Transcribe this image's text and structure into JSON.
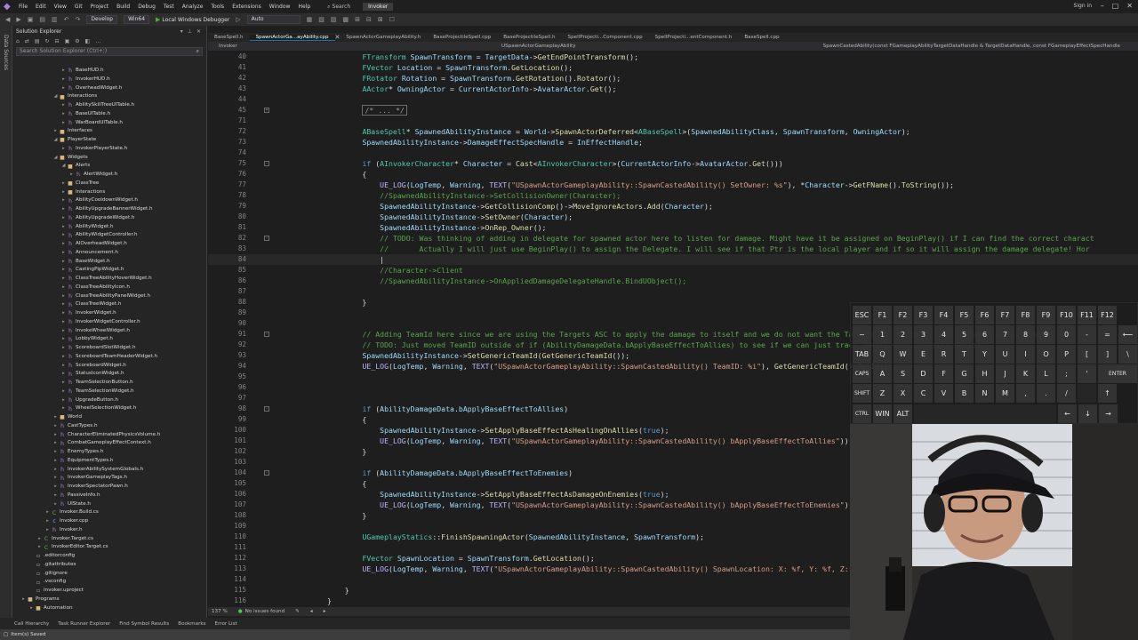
{
  "menubar": {
    "items": [
      "File",
      "Edit",
      "View",
      "Git",
      "Project",
      "Build",
      "Debug",
      "Test",
      "Analyze",
      "Tools",
      "Extensions",
      "Window",
      "Help"
    ],
    "search_label": "Search",
    "solution_name": "Invoker",
    "signin": "Sign in"
  },
  "toolbar": {
    "config": "Develop",
    "platform": "Win64",
    "debugger": "Local Windows Debugger",
    "auto": "Auto"
  },
  "leftstrip": {
    "label": "Data Sources"
  },
  "solution_explorer": {
    "title": "Solution Explorer",
    "search_placeholder": "Search Solution Explorer (Ctrl+;)",
    "tree": [
      {
        "label": "BaseHUD.h",
        "icon": "file-h",
        "indent": 6,
        "arrow": "▸"
      },
      {
        "label": "InvokerHUD.h",
        "icon": "file-h",
        "indent": 6,
        "arrow": "▸"
      },
      {
        "label": "OverheadWidget.h",
        "icon": "file-h",
        "indent": 6,
        "arrow": "▸"
      },
      {
        "label": "Interactions",
        "icon": "folder",
        "indent": 5,
        "arrow": "◢"
      },
      {
        "label": "AbilitySkillTreeUITable.h",
        "icon": "file-h",
        "indent": 6,
        "arrow": "▸"
      },
      {
        "label": "BaseUITable.h",
        "icon": "file-h",
        "indent": 6,
        "arrow": "▸"
      },
      {
        "label": "WarBoardUITable.h",
        "icon": "file-h",
        "indent": 6,
        "arrow": "▸"
      },
      {
        "label": "Interfaces",
        "icon": "folder",
        "indent": 5,
        "arrow": "▸"
      },
      {
        "label": "PlayerState",
        "icon": "folder",
        "indent": 5,
        "arrow": "◢"
      },
      {
        "label": "InvokerPlayerState.h",
        "icon": "file-h",
        "indent": 6,
        "arrow": "▸"
      },
      {
        "label": "Widgets",
        "icon": "folder",
        "indent": 5,
        "arrow": "◢"
      },
      {
        "label": "Alerts",
        "icon": "folder",
        "indent": 6,
        "arrow": "◢"
      },
      {
        "label": "AlertWidget.h",
        "icon": "file-h",
        "indent": 7,
        "arrow": "▸"
      },
      {
        "label": "ClassTree",
        "icon": "folder",
        "indent": 6,
        "arrow": "▸"
      },
      {
        "label": "Interactions",
        "icon": "folder",
        "indent": 6,
        "arrow": "▸"
      },
      {
        "label": "AbilityCooldownWidget.h",
        "icon": "file-h",
        "indent": 6,
        "arrow": "▸"
      },
      {
        "label": "AbilityUpgradeBannerWidget.h",
        "icon": "file-h",
        "indent": 6,
        "arrow": "▸"
      },
      {
        "label": "AbilityUpgradeWidget.h",
        "icon": "file-h",
        "indent": 6,
        "arrow": "▸"
      },
      {
        "label": "AbilityWidget.h",
        "icon": "file-h",
        "indent": 6,
        "arrow": "▸"
      },
      {
        "label": "AbilityWidgetController.h",
        "icon": "file-h",
        "indent": 6,
        "arrow": "▸"
      },
      {
        "label": "AIOverheadWidget.h",
        "icon": "file-h",
        "indent": 6,
        "arrow": "▸"
      },
      {
        "label": "Announcement.h",
        "icon": "file-h",
        "indent": 6,
        "arrow": "▸"
      },
      {
        "label": "BaseWidget.h",
        "icon": "file-h",
        "indent": 6,
        "arrow": "▸"
      },
      {
        "label": "CastingPipWidget.h",
        "icon": "file-h",
        "indent": 6,
        "arrow": "▸"
      },
      {
        "label": "ClassTreeAbilityHoverWidget.h",
        "icon": "file-h",
        "indent": 6,
        "arrow": "▸"
      },
      {
        "label": "ClassTreeAbilityIcon.h",
        "icon": "file-h",
        "indent": 6,
        "arrow": "▸"
      },
      {
        "label": "ClassTreeAbilityPanelWidget.h",
        "icon": "file-h",
        "indent": 6,
        "arrow": "▸"
      },
      {
        "label": "ClassTreeWidget.h",
        "icon": "file-h",
        "indent": 6,
        "arrow": "▸"
      },
      {
        "label": "InvokerWidget.h",
        "icon": "file-h",
        "indent": 6,
        "arrow": "▸"
      },
      {
        "label": "InvokerWidgetController.h",
        "icon": "file-h",
        "indent": 6,
        "arrow": "▸"
      },
      {
        "label": "InvokeWheelWidget.h",
        "icon": "file-h",
        "indent": 6,
        "arrow": "▸"
      },
      {
        "label": "LobbyWidget.h",
        "icon": "file-h",
        "indent": 6,
        "arrow": "▸"
      },
      {
        "label": "ScoreboardSlotWidget.h",
        "icon": "file-h",
        "indent": 6,
        "arrow": "▸"
      },
      {
        "label": "ScoreboardTeamHeaderWidget.h",
        "icon": "file-h",
        "indent": 6,
        "arrow": "▸"
      },
      {
        "label": "ScoreboardWidget.h",
        "icon": "file-h",
        "indent": 6,
        "arrow": "▸"
      },
      {
        "label": "StatusIconWidget.h",
        "icon": "file-h",
        "indent": 6,
        "arrow": "▸"
      },
      {
        "label": "TeamSelectionButton.h",
        "icon": "file-h",
        "indent": 6,
        "arrow": "▸"
      },
      {
        "label": "TeamSelectionWidget.h",
        "icon": "file-h",
        "indent": 6,
        "arrow": "▸"
      },
      {
        "label": "UpgradeButton.h",
        "icon": "file-h",
        "indent": 6,
        "arrow": "▸"
      },
      {
        "label": "WheelSelectionWidget.h",
        "icon": "file-h",
        "indent": 6,
        "arrow": "▸"
      },
      {
        "label": "World",
        "icon": "folder",
        "indent": 5,
        "arrow": "▸"
      },
      {
        "label": "CastTypes.h",
        "icon": "file-h",
        "indent": 5,
        "arrow": "▸"
      },
      {
        "label": "CharacterEliminatedPhysicsVolume.h",
        "icon": "file-h",
        "indent": 5,
        "arrow": "▸"
      },
      {
        "label": "CombatGameplayEffectContext.h",
        "icon": "file-h",
        "indent": 5,
        "arrow": "▸"
      },
      {
        "label": "EnemyTypes.h",
        "icon": "file-h",
        "indent": 5,
        "arrow": "▸"
      },
      {
        "label": "EquipmentTypes.h",
        "icon": "file-h",
        "indent": 5,
        "arrow": "▸"
      },
      {
        "label": "InvokerAbilitySystemGlobals.h",
        "icon": "file-h",
        "indent": 5,
        "arrow": "▸"
      },
      {
        "label": "InvokerGameplayTags.h",
        "icon": "file-h",
        "indent": 5,
        "arrow": "▸"
      },
      {
        "label": "InvokerSpectatorPawn.h",
        "icon": "file-h",
        "indent": 5,
        "arrow": "▸"
      },
      {
        "label": "PassiveInfo.h",
        "icon": "file-h",
        "indent": 5,
        "arrow": "▸"
      },
      {
        "label": "UIState.h",
        "icon": "file-h",
        "indent": 5,
        "arrow": "▸"
      },
      {
        "label": "Invoker.Build.cs",
        "icon": "file-cs",
        "indent": 4,
        "arrow": "▸"
      },
      {
        "label": "Invoker.cpp",
        "icon": "file-cpp",
        "indent": 4,
        "arrow": "▸"
      },
      {
        "label": "Invoker.h",
        "icon": "file-h",
        "indent": 4,
        "arrow": "▸"
      },
      {
        "label": "Invoker.Target.cs",
        "icon": "file-cs",
        "indent": 3,
        "arrow": "▸"
      },
      {
        "label": "InvokerEditor.Target.cs",
        "icon": "file-cs",
        "indent": 3,
        "arrow": "▸"
      },
      {
        "label": ".editorconfig",
        "icon": "file-other",
        "indent": 2,
        "arrow": ""
      },
      {
        "label": ".gitattributes",
        "icon": "file-other",
        "indent": 2,
        "arrow": ""
      },
      {
        "label": ".gitignore",
        "icon": "file-other",
        "indent": 2,
        "arrow": ""
      },
      {
        "label": ".vsconfig",
        "icon": "file-other",
        "indent": 2,
        "arrow": ""
      },
      {
        "label": "Invoker.uproject",
        "icon": "file-other",
        "indent": 2,
        "arrow": ""
      },
      {
        "label": "Programs",
        "icon": "folder",
        "indent": 1,
        "arrow": "▸"
      },
      {
        "label": "Automation",
        "icon": "folder",
        "indent": 2,
        "arrow": "▸"
      }
    ]
  },
  "tabs": [
    {
      "label": "BaseSpell.h",
      "active": false
    },
    {
      "label": "SpawnActorGa...ayAbility.cpp",
      "active": true
    },
    {
      "label": "SpawnActorGameplayAbility.h",
      "active": false
    },
    {
      "label": "BaseProjectileSpell.cpp",
      "active": false
    },
    {
      "label": "BaseProjectileSpell.h",
      "active": false
    },
    {
      "label": "SpellProjecti...Component.cpp",
      "active": false
    },
    {
      "label": "SpellProjecti...entComponent.h",
      "active": false
    },
    {
      "label": "BaseSpell.cpp",
      "active": false
    }
  ],
  "navbar": {
    "project": "Invoker",
    "class": "USpawnActorGameplayAbility",
    "member": "SpawnCastedAbility(const FGameplayAbilityTargetDataHandle & TargetDataHandle, const FGameplayEffectSpecHandle"
  },
  "code_lines": [
    {
      "n": "40",
      "fold": "",
      "html": "        <span class='ty'>FTransform</span> <span class='vr'>SpawnTransform</span> = <span class='vr'>TargetData</span>-><span class='fn'>GetEndPointTransform</span>();"
    },
    {
      "n": "41",
      "fold": "",
      "html": "        <span class='ty'>FVector</span> <span class='vr'>Location</span> = <span class='vr'>SpawnTransform</span>.<span class='fn'>GetLocation</span>();"
    },
    {
      "n": "42",
      "fold": "",
      "html": "        <span class='ty'>FRotator</span> <span class='vr'>Rotation</span> = <span class='vr'>SpawnTransform</span>.<span class='fn'>GetRotation</span>().<span class='fn'>Rotator</span>();"
    },
    {
      "n": "43",
      "fold": "",
      "html": "        <span class='ty'>AActor</span>* <span class='vr'>OwningActor</span> = <span class='vr'>CurrentActorInfo</span>-><span class='vr'>AvatarActor</span>.<span class='fn'>Get</span>();"
    },
    {
      "n": "44",
      "fold": "",
      "html": ""
    },
    {
      "n": "45",
      "fold": "+",
      "html": "        <span class='collapsed-box cm'>/* ... */</span>"
    },
    {
      "n": "71",
      "fold": "",
      "html": ""
    },
    {
      "n": "72",
      "fold": "",
      "html": "        <span class='ty'>ABaseSpell</span>* <span class='vr'>SpawnedAbilityInstance</span> = <span class='vr'>World</span>-><span class='fn'>SpawnActorDeferred</span>&lt;<span class='ty'>ABaseSpell</span>&gt;(<span class='vr'>SpawnedAbilityClass</span>, <span class='vr'>SpawnTransform</span>, <span class='vr'>OwningActor</span>);"
    },
    {
      "n": "73",
      "fold": "",
      "html": "        <span class='vr'>SpawnedAbilityInstance</span>-><span class='vr'>DamageEffectSpecHandle</span> = <span class='vr'>InEffectHandle</span>;"
    },
    {
      "n": "74",
      "fold": "",
      "html": ""
    },
    {
      "n": "75",
      "fold": "-",
      "html": "        <span class='kw'>if</span> (<span class='ty'>AInvokerCharacter</span>* <span class='vr'>Character</span> = <span class='fn'>Cast</span>&lt;<span class='ty'>AInvokerCharacter</span>&gt;(<span class='vr'>CurrentActorInfo</span>-><span class='vr'>AvatarActor</span>.<span class='fn'>Get</span>()))"
    },
    {
      "n": "76",
      "fold": "",
      "html": "        {"
    },
    {
      "n": "77",
      "fold": "",
      "html": "            <span class='mc'>UE_LOG</span>(<span class='vr'>LogTemp</span>, <span class='vr'>Warning</span>, <span class='mc'>TEXT</span>(<span class='st'>\"USpawnActorGameplayAbility::SpawnCastedAbility() SetOwner: %s\"</span>), *<span class='vr'>Character</span>-><span class='fn'>GetFName</span>().<span class='fn'>ToString</span>());"
    },
    {
      "n": "78",
      "fold": "",
      "html": "            <span class='cm'>//SpawnedAbilityInstance->SetCollisionOwner(Character);</span>"
    },
    {
      "n": "79",
      "fold": "",
      "html": "            <span class='vr'>SpawnedAbilityInstance</span>-><span class='fn'>GetCollisionComp</span>()-><span class='fn'>MoveIgnoreActors</span>.<span class='fn'>Add</span>(<span class='vr'>Character</span>);"
    },
    {
      "n": "80",
      "fold": "",
      "html": "            <span class='vr'>SpawnedAbilityInstance</span>-><span class='fn'>SetOwner</span>(<span class='vr'>Character</span>);"
    },
    {
      "n": "81",
      "fold": "",
      "html": "            <span class='vr'>SpawnedAbilityInstance</span>-><span class='fn'>OnRep_Owner</span>();"
    },
    {
      "n": "82",
      "fold": "-",
      "html": "            <span class='cm'>// TODO: Was thinking of adding in delegate for spawned actor here to listen for damage. Might have it be assigned on BeginPlay() if I can find the correct charact</span>"
    },
    {
      "n": "83",
      "fold": "",
      "html": "            <span class='cm'>//       Actually I will just use BeginPlay() to assign the Delegate. I will see if that Ptr is the local player and if so it will assign the damage delegate! Hor</span>"
    },
    {
      "n": "84",
      "fold": "",
      "html": "            |",
      "current": true
    },
    {
      "n": "85",
      "fold": "",
      "html": "            <span class='cm'>//Character->Client</span>"
    },
    {
      "n": "86",
      "fold": "",
      "html": "            <span class='cm'>//SpawnedAbilityInstance->OnAppliedDamageDelegateHandle.BindUObject();</span>"
    },
    {
      "n": "87",
      "fold": "",
      "html": ""
    },
    {
      "n": "88",
      "fold": "",
      "html": "        }"
    },
    {
      "n": "89",
      "fold": "",
      "html": ""
    },
    {
      "n": "90",
      "fold": "",
      "html": ""
    },
    {
      "n": "91",
      "fold": "-",
      "html": "        <span class='cm'>// Adding TeamId here since we are using the Targets ASC to apply the damage to itself and we do not want the Targets ASC to track GenericTeamId with itself.</span>"
    },
    {
      "n": "92",
      "fold": "",
      "html": "        <span class='cm'>// TODO: Just moved TeamID outside of if (AbilityDamageData.bApplyBaseEffectToAllies) to see if we can just track TeamID when applying damage.</span>"
    },
    {
      "n": "93",
      "fold": "",
      "html": "        <span class='vr'>SpawnedAbilityInstance</span>-><span class='fn'>SetGenericTeamId</span>(<span class='fn'>GetGenericTeamId</span>());"
    },
    {
      "n": "94",
      "fold": "",
      "html": "        <span class='mc'>UE_LOG</span>(<span class='vr'>LogTemp</span>, <span class='vr'>Warning</span>, <span class='mc'>TEXT</span>(<span class='st'>\"USpawnActorGameplayAbility::SpawnCastedAbility() TeamID: %i\"</span>), <span class='fn'>GetGenericTeamId</span>().<span class='fn'>GetId</span>());"
    },
    {
      "n": "95",
      "fold": "",
      "html": ""
    },
    {
      "n": "96",
      "fold": "",
      "html": ""
    },
    {
      "n": "97",
      "fold": "",
      "html": ""
    },
    {
      "n": "98",
      "fold": "-",
      "html": "        <span class='kw'>if</span> (<span class='vr'>AbilityDamageData</span>.<span class='vr'>bApplyBaseEffectToAllies</span>)"
    },
    {
      "n": "99",
      "fold": "",
      "html": "        {"
    },
    {
      "n": "100",
      "fold": "",
      "html": "            <span class='vr'>SpawnedAbilityInstance</span>-><span class='fn'>SetApplyBaseEffectAsHealingOnAllies</span>(<span class='kw'>true</span>);"
    },
    {
      "n": "101",
      "fold": "",
      "html": "            <span class='mc'>UE_LOG</span>(<span class='vr'>LogTemp</span>, <span class='vr'>Warning</span>, <span class='mc'>TEXT</span>(<span class='st'>\"USpawnActorGameplayAbility::SpawnCastedAbility() bApplyBaseEffectToAllies\"</span>));"
    },
    {
      "n": "102",
      "fold": "",
      "html": "        }"
    },
    {
      "n": "103",
      "fold": "",
      "html": ""
    },
    {
      "n": "104",
      "fold": "-",
      "html": "        <span class='kw'>if</span> (<span class='vr'>AbilityDamageData</span>.<span class='vr'>bApplyBaseEffectToEnemies</span>)"
    },
    {
      "n": "105",
      "fold": "",
      "html": "        {"
    },
    {
      "n": "106",
      "fold": "",
      "html": "            <span class='vr'>SpawnedAbilityInstance</span>-><span class='fn'>SetApplyBaseEffectAsDamageOnEnemies</span>(<span class='kw'>true</span>);"
    },
    {
      "n": "107",
      "fold": "",
      "html": "            <span class='mc'>UE_LOG</span>(<span class='vr'>LogTemp</span>, <span class='vr'>Warning</span>, <span class='mc'>TEXT</span>(<span class='st'>\"USpawnActorGameplayAbility::SpawnCastedAbility() bApplyBaseEffectToEnemies\"</span>));"
    },
    {
      "n": "108",
      "fold": "",
      "html": "        }"
    },
    {
      "n": "109",
      "fold": "",
      "html": ""
    },
    {
      "n": "110",
      "fold": "",
      "html": "        <span class='ty'>UGameplayStatics</span>::<span class='fn'>FinishSpawningActor</span>(<span class='vr'>SpawnedAbilityInstance</span>, <span class='vr'>SpawnTransform</span>);"
    },
    {
      "n": "111",
      "fold": "",
      "html": ""
    },
    {
      "n": "112",
      "fold": "",
      "html": "        <span class='ty'>FVector</span> <span class='vr'>SpawnLocation</span> = <span class='vr'>SpawnTransform</span>.<span class='fn'>GetLocation</span>();"
    },
    {
      "n": "113",
      "fold": "",
      "html": "        <span class='mc'>UE_LOG</span>(<span class='vr'>LogTemp</span>, <span class='vr'>Warning</span>, <span class='mc'>TEXT</span>(<span class='st'>\"USpawnActorGameplayAbility::SpawnCastedAbility() SpawnLocation: X: %f, Y: %f, Z: %f\"</span>));"
    },
    {
      "n": "114",
      "fold": "",
      "html": ""
    },
    {
      "n": "115",
      "fold": "",
      "html": "    }"
    },
    {
      "n": "116",
      "fold": "",
      "html": "}"
    }
  ],
  "editor_status": {
    "zoom": "137 %",
    "issues": "No issues found"
  },
  "bottom_tabs": [
    "Call Hierarchy",
    "Task Runner Explorer",
    "Find Symbol Results",
    "Bookmarks",
    "Error List"
  ],
  "statusbar": {
    "text": "Item(s) Saved"
  },
  "keyboard": {
    "rows": [
      [
        "ESC",
        "F1",
        "F2",
        "F3",
        "F4",
        "F5",
        "F6",
        "F7",
        "F8",
        "F9",
        "F10",
        "F11",
        "F12"
      ],
      [
        "~",
        "1",
        "2",
        "3",
        "4",
        "5",
        "6",
        "7",
        "8",
        "9",
        "0",
        "-",
        "=",
        "⟵"
      ],
      [
        "TAB",
        "Q",
        "W",
        "E",
        "R",
        "T",
        "Y",
        "U",
        "I",
        "O",
        "P",
        "[",
        "]",
        "\\"
      ],
      [
        "CAPS",
        "A",
        "S",
        "D",
        "F",
        "G",
        "H",
        "J",
        "K",
        "L",
        ";",
        "'",
        "ENTER"
      ],
      [
        "SHIFT",
        "Z",
        "X",
        "C",
        "V",
        "B",
        "N",
        "M",
        ",",
        ".",
        "/",
        "",
        "↑"
      ],
      [
        "CTRL",
        "WIN",
        "ALT",
        "",
        "←",
        "↓",
        "→"
      ]
    ]
  },
  "colors": {
    "accent": "#007acc",
    "background": "#1e1e1e"
  }
}
